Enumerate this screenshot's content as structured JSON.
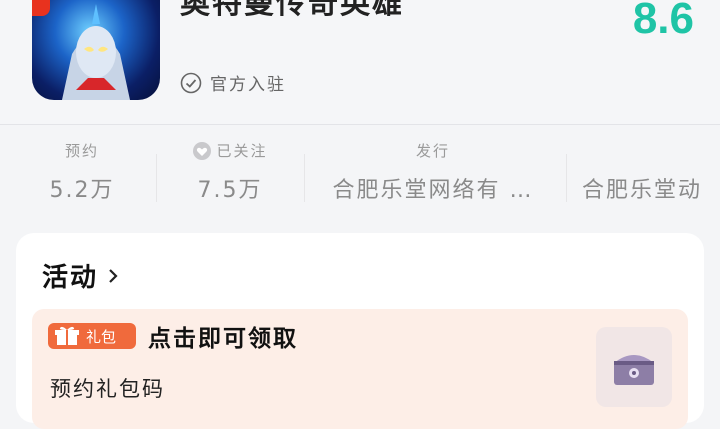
{
  "app": {
    "title_partial": "奥特曼传奇英雄",
    "verified_label": "官方入驻",
    "score": "8.6",
    "accent_color": "#1fc4a6"
  },
  "stats": [
    {
      "label": "预约",
      "value": "5.2万"
    },
    {
      "label": "已关注",
      "value": "7.5万",
      "icon": "heart-icon"
    },
    {
      "label": "发行",
      "value": "合肥乐堂网络有 …"
    },
    {
      "label": "",
      "value": "合肥乐堂动"
    }
  ],
  "activity": {
    "section_title": "活动",
    "gift": {
      "tag_label": "礼包",
      "cta": "点击即可领取",
      "name": "预约礼包码",
      "tag_color": "#f06a3c",
      "bg_color": "#fdeee7"
    }
  }
}
